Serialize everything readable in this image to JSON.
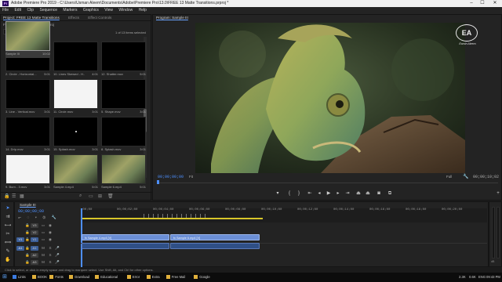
{
  "window": {
    "app_icon": "Pr",
    "title": "Adobe Premiere Pro 2019 - C:\\Users\\Usman Aleem\\Documents\\Adobe\\Premiere Pro\\13.0\\FREE 13 Matte Transitions.prproj *",
    "minimize": "–",
    "maximize": "☐",
    "close": "✕"
  },
  "menu": [
    "File",
    "Edit",
    "Clip",
    "Sequence",
    "Markers",
    "Graphics",
    "View",
    "Window",
    "Help"
  ],
  "project_panel": {
    "tabs": [
      "Project: FREE 13 Matte Transitions",
      "Effects",
      "Effect Controls"
    ],
    "file_name": "FREE 13 Matte Transitions.prproj",
    "search_value": "ρ",
    "selection_status": "1 of 13 items selected",
    "items": [
      {
        "name": "2. Circle - Horizontal...",
        "duration": "5:01",
        "style": "black"
      },
      {
        "name": "10. Lines Skewed - H...",
        "duration": "4:01",
        "style": "black"
      },
      {
        "name": "12. Shatter.mov",
        "duration": "5:01",
        "style": "black"
      },
      {
        "name": "3. Line - Vertical.mov",
        "duration": "3:01",
        "style": "black"
      },
      {
        "name": "11. Circle.mov",
        "duration": "3:01",
        "style": "white"
      },
      {
        "name": "5. Shape.mov",
        "duration": "3:01",
        "style": "black"
      },
      {
        "name": "14. Drip.mov",
        "duration": "3:01",
        "style": "black"
      },
      {
        "name": "15. Splash.mov",
        "duration": "3:01",
        "style": "dot"
      },
      {
        "name": "8. Splash.mov",
        "duration": "3:01",
        "style": "black"
      },
      {
        "name": "9. Burn - 3.mov",
        "duration": "3:01",
        "style": "white"
      },
      {
        "name": "Sample 4.mp4",
        "duration": "5:01",
        "style": "image"
      },
      {
        "name": "Sample 6.mp4",
        "duration": "5:01",
        "style": "image"
      },
      {
        "name": "Sample III",
        "duration": "10:02",
        "style": "image",
        "selected": true
      }
    ]
  },
  "program_monitor": {
    "tab": "Program: Sample III",
    "current_timecode": "00;00;00;00",
    "fit": "Fit",
    "quality": "Full",
    "total_duration": "00;00;10;02",
    "watermark_line1": "EA",
    "watermark_line2": "Eamin Aleem",
    "controls": [
      "marker-add",
      "in-point",
      "out-point",
      "go-to-in",
      "step-back",
      "play",
      "step-forward",
      "go-to-out",
      "lift",
      "extract",
      "export-frame",
      "settings"
    ]
  },
  "timeline": {
    "tab": "Sample III",
    "timecode": "00;00;00;00",
    "ruler_labels": [
      ":00;00",
      "00;00;02;00",
      "00;00;04;00",
      "00;00;06;00",
      "00;00;08;00",
      "00;00;10;00",
      "00;00;12;00",
      "00;00;14;00",
      "00;00;16;00",
      "00;00;18;00",
      "00;00;20;00"
    ],
    "tracks": [
      {
        "name": "V3",
        "source": ""
      },
      {
        "name": "V2",
        "source": ""
      },
      {
        "name": "V1",
        "source": "V1"
      },
      {
        "name": "A1",
        "source": "A1"
      },
      {
        "name": "A2",
        "source": ""
      },
      {
        "name": "A3",
        "source": ""
      }
    ],
    "clips": [
      {
        "label": "fx Sample 4.mp4 [V]",
        "track": "V1"
      },
      {
        "label": "fx Sample 6.mp4 [V]",
        "track": "V1"
      },
      {
        "label": "",
        "track": "A1"
      },
      {
        "label": "",
        "track": "A1"
      }
    ],
    "audio_meter": [
      "0",
      "-12",
      "-24",
      "-36",
      "-48",
      "dB"
    ]
  },
  "status_bar": {
    "hint": "Click to select, or click in empty space and drag to marquee select. Use Shift, Alt, and Ctrl for other options."
  },
  "taskbar": {
    "items": [
      {
        "label": "Links",
        "color": "#3b7be0"
      },
      {
        "label": "BOOK",
        "color": "#e0b03b"
      },
      {
        "label": "Fonts",
        "color": "#e0b03b"
      },
      {
        "label": "Download",
        "color": "#e0b03b"
      },
      {
        "label": "Educational",
        "color": "#e0b03b"
      },
      {
        "label": "Error",
        "color": "#e0b03b"
      },
      {
        "label": "Extra",
        "color": "#e0b03b"
      },
      {
        "label": "Free Mail",
        "color": "#e0b03b"
      },
      {
        "label": "Google",
        "color": "#e0b03b"
      }
    ],
    "tray": [
      "2.3K",
      "0.6K",
      "ENG"
    ],
    "clock": "09:43 PM"
  }
}
